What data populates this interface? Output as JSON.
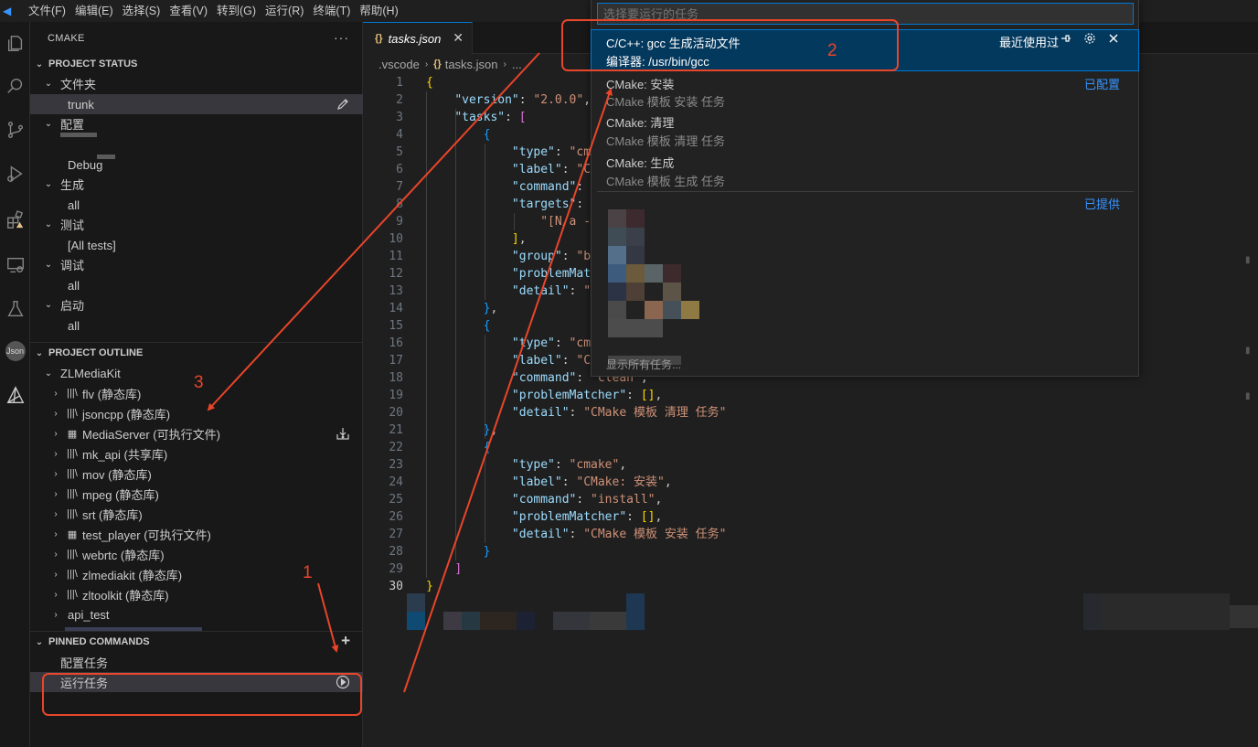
{
  "menubar": {
    "logo": "◀",
    "items": [
      "文件(F)",
      "编辑(E)",
      "选择(S)",
      "查看(V)",
      "转到(G)",
      "运行(R)",
      "终端(T)",
      "帮助(H)"
    ]
  },
  "activity_icons": [
    "explorer-icon",
    "search-icon",
    "source-control-icon",
    "run-debug-icon",
    "extensions-icon",
    "remote-explorer-icon",
    "testing-icon",
    "json-icon",
    "cmake-icon"
  ],
  "activity_json_label": "Json",
  "sidebar": {
    "title": "CMAKE",
    "more": "···",
    "project_status": {
      "header": "PROJECT STATUS",
      "folder_label": "文件夹",
      "folder_value": "trunk",
      "config_label": "配置",
      "config_value": "Debug",
      "build_label": "生成",
      "build_value": "all",
      "test_label": "测试",
      "test_value": "[All tests]",
      "debug_label": "调试",
      "debug_value": "all",
      "launch_label": "启动",
      "launch_value": "all"
    },
    "project_outline": {
      "header": "PROJECT OUTLINE",
      "root": "ZLMediaKit",
      "targets": [
        {
          "name": "flv (静态库)",
          "icon": "library-icon"
        },
        {
          "name": "jsoncpp (静态库)",
          "icon": "library-icon"
        },
        {
          "name": "MediaServer (可执行文件)",
          "icon": "executable-icon"
        },
        {
          "name": "mk_api (共享库)",
          "icon": "library-icon"
        },
        {
          "name": "mov (静态库)",
          "icon": "library-icon"
        },
        {
          "name": "mpeg (静态库)",
          "icon": "library-icon"
        },
        {
          "name": "srt (静态库)",
          "icon": "library-icon"
        },
        {
          "name": "test_player (可执行文件)",
          "icon": "executable-icon"
        },
        {
          "name": "webrtc (静态库)",
          "icon": "library-icon"
        },
        {
          "name": "zlmediakit (静态库)",
          "icon": "library-icon"
        },
        {
          "name": "zltoolkit (静态库)",
          "icon": "library-icon"
        }
      ],
      "folder": "api_test"
    },
    "pinned_commands": {
      "header": "PINNED COMMANDS",
      "add": "+",
      "items": [
        "配置任务",
        "运行任务"
      ]
    }
  },
  "editor": {
    "tab_icon": "{}",
    "tab_label": "tasks.json",
    "tab_close": "✕",
    "breadcrumb": [
      ".vscode",
      "tasks.json",
      "..."
    ],
    "line_numbers": [
      "1",
      "2",
      "3",
      "4",
      "5",
      "6",
      "7",
      "8",
      "9",
      "10",
      "11",
      "12",
      "13",
      "14",
      "15",
      "16",
      "17",
      "18",
      "19",
      "20",
      "21",
      "22",
      "23",
      "24",
      "25",
      "26",
      "27",
      "28",
      "29",
      "30"
    ],
    "code": {
      "l2_key": "\"version\"",
      "l2_val": "\"2.0.0\"",
      "l3_key": "\"tasks\"",
      "type_key": "\"type\"",
      "label_key": "\"label\"",
      "command_key": "\"command\"",
      "targets_key": "\"targets\"",
      "group_key": "\"group\"",
      "pm_key": "\"problemMatcher\"",
      "detail_key": "\"detail\"",
      "l5_val_part": "\"cma",
      "l6_val_part": "\"CM",
      "l9_val_part": "\"[N/a -",
      "l11_val_part": "\"bu",
      "l13_val_part": "\"C",
      "l16_val_part": "\"cma",
      "l17_val_part": "\"CM",
      "l18_val": "\"clean\"",
      "l20_val": "\"CMake 模板 清理 任务\"",
      "l23_val": "\"cmake\"",
      "l24_val": "\"CMake: 安装\"",
      "l25_val": "\"install\"",
      "l27_val": "\"CMake 模板 安装 任务\""
    }
  },
  "quickpick": {
    "placeholder": "选择要运行的任务",
    "items": [
      {
        "label": "C/C++: gcc 生成活动文件",
        "detail": "编译器: /usr/bin/gcc",
        "recent": "最近使用过"
      },
      {
        "label": "CMake: 安装",
        "detail": "CMake 模板 安装 任务",
        "group": "已配置"
      },
      {
        "label": "CMake: 清理",
        "detail": "CMake 模板 清理 任务"
      },
      {
        "label": "CMake: 生成",
        "detail": "CMake 模板 生成 任务"
      }
    ],
    "provided_group": "已提供",
    "show_all": "显示所有任务..."
  },
  "annotations": {
    "one": "1",
    "two": "2",
    "three": "3",
    "color": "#e8452a"
  }
}
